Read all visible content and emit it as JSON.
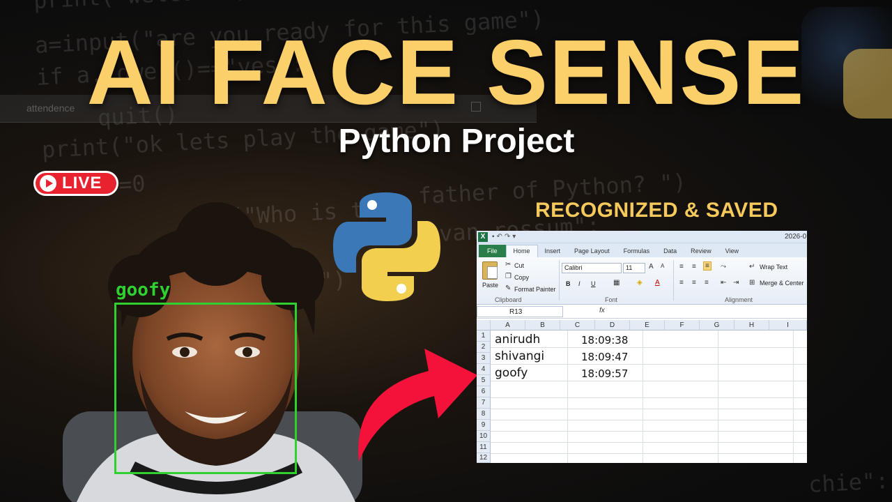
{
  "title": "AI FACE SENSE",
  "subtitle": "Python Project",
  "live_badge": "LIVE",
  "background_window_title": "attendence",
  "background_code": [
    "print(\"welcome\")",
    "a=input(\"are you ready for this game\")",
    "if a.lower()==\"yes\":",
    "quit()",
    "print(\"ok lets play the game\")",
    "=0",
    "father of Python? \")",
    "(\"Who is t",
    "==",
    "ct\")",
    "van rossum\":",
    "chie\":"
  ],
  "face_label": "goofy",
  "recognized_text": "RECOGNIZED & SAVED",
  "colors": {
    "title": "#fbd06a",
    "face_box": "#30d030",
    "arrow": "#f4123a",
    "live_badge": "#e8232f",
    "recognized": "#f5c95c"
  },
  "excel": {
    "doc_title": "2026-0",
    "tabs": [
      "File",
      "Home",
      "Insert",
      "Page Layout",
      "Formulas",
      "Data",
      "Review",
      "View"
    ],
    "active_tab": "Home",
    "clipboard": {
      "paste": "Paste",
      "cut": "Cut",
      "copy": "Copy",
      "format_painter": "Format Painter",
      "group": "Clipboard"
    },
    "font": {
      "name": "Calibri",
      "size": "11",
      "group": "Font",
      "bold": "B",
      "italic": "I",
      "underline": "U"
    },
    "alignment": {
      "wrap_text": "Wrap Text",
      "merge_center": "Merge & Center",
      "group": "Alignment"
    },
    "name_box": "R13",
    "fx": "fx",
    "columns": [
      "A",
      "B",
      "C",
      "D",
      "E",
      "F",
      "G",
      "H",
      "I"
    ],
    "rows": [
      "1",
      "2",
      "3",
      "4",
      "5",
      "6",
      "7",
      "8",
      "9",
      "10",
      "11",
      "12"
    ],
    "records": [
      {
        "name": "anirudh",
        "time": "18:09:38"
      },
      {
        "name": "shivangi",
        "time": "18:09:47"
      },
      {
        "name": "goofy",
        "time": "18:09:57"
      }
    ]
  }
}
